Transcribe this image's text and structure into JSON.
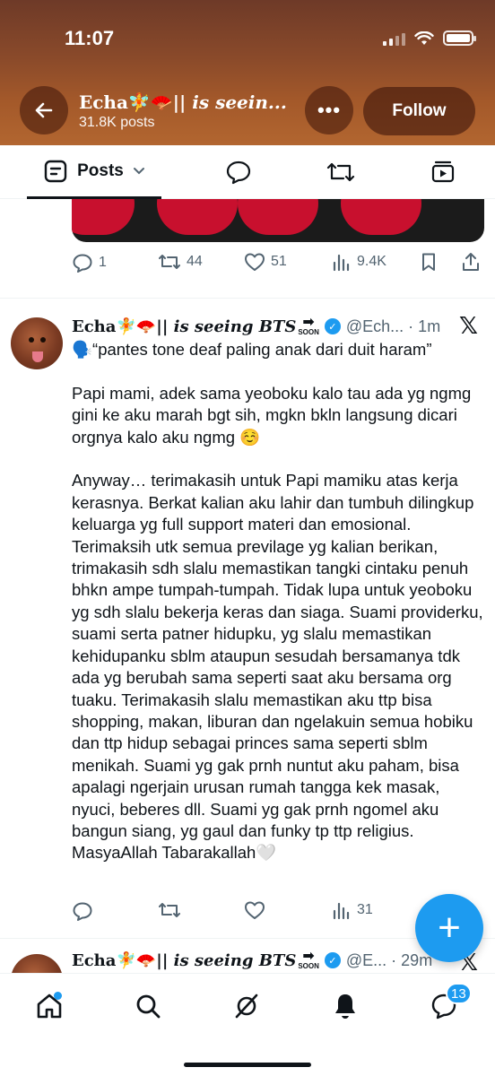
{
  "status_bar": {
    "time": "11:07"
  },
  "header": {
    "profile_name_plain": "Echa",
    "profile_name_italic": "is seein...",
    "post_count": "31.8K posts",
    "follow_label": "Follow",
    "colors": {
      "gradient_top": "#6e3a28",
      "gradient_bottom": "#b26630"
    }
  },
  "tabs": {
    "posts_label": "Posts"
  },
  "prev_tweet": {
    "replies": "1",
    "reposts": "44",
    "likes": "51",
    "views": "9.4K"
  },
  "tweet": {
    "name_plain": "Echa",
    "name_italic": "is seeing BTS",
    "soon": "SOON",
    "handle": "@Ech... · 1m",
    "body": "🗣️“pantes tone deaf paling anak dari duit haram”\n\nPapi mami, adek sama yeoboku kalo tau ada yg ngmg gini ke aku marah bgt sih, mgkn bkln langsung dicari orgnya kalo aku ngmg ☺️\n\nAnyway… terimakasih untuk Papi mamiku atas kerja kerasnya. Berkat kalian aku lahir dan tumbuh dilingkup keluarga yg full support materi dan emosional. Terimaksih utk semua previlage yg kalian berikan, trimakasih sdh slalu memastikan tangki cintaku penuh bhkn ampe tumpah-tumpah. Tidak lupa untuk yeoboku yg sdh slalu bekerja keras dan siaga. Suami providerku, suami serta patner hidupku, yg slalu memastikan kehidupanku sblm ataupun sesudah bersamanya tdk ada yg berubah sama seperti saat aku bersama org tuaku. Terimakasih slalu memastikan aku ttp bisa shopping, makan, liburan dan ngelakuin semua hobiku dan ttp hidup sebagai princes sama seperti sblm menikah. Suami yg gak prnh nuntut aku paham, bisa apalagi ngerjain urusan rumah tangga kek masak, nyuci, beberes dll. Suami yg gak prnh ngomel aku bangun siang, yg gaul dan funky tp ttp religius. MasyaAllah Tabarakallah🤍",
    "views": "31"
  },
  "next_tweet": {
    "name_plain": "Echa",
    "name_italic": "is seeing BTS",
    "soon": "SOON",
    "handle": "@E... · 29m"
  },
  "bottom_nav": {
    "messages_badge": "13"
  },
  "icons": [
    "back-arrow-icon",
    "more-icon",
    "posts-icon",
    "chevron-down-icon",
    "reply-icon",
    "repost-icon",
    "media-icon",
    "heart-icon",
    "views-icon",
    "bookmark-icon",
    "share-icon",
    "x-logo-icon",
    "compose-icon",
    "home-icon",
    "search-icon",
    "grok-icon",
    "notifications-icon",
    "messages-icon",
    "verified-icon"
  ],
  "accent": "#1d9bf0"
}
